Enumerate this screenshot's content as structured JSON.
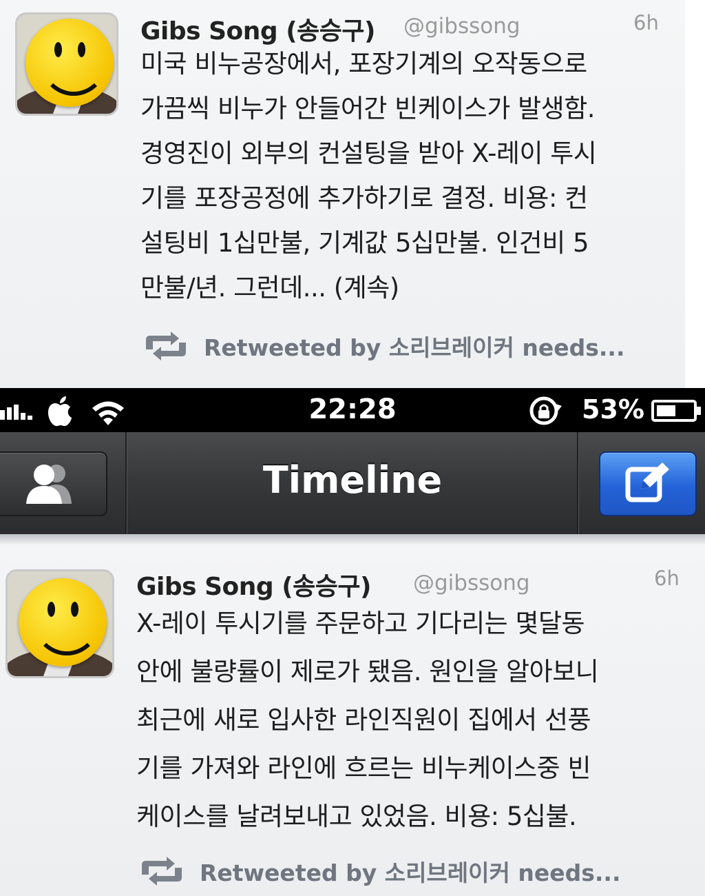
{
  "tweets": [
    {
      "name": "Gibs Song (송승구)",
      "handle": "@gibssong",
      "time": "6h",
      "lines": [
        "미국 비누공장에서, 포장기계의 오작동으로",
        "가끔씩 비누가 안들어간 빈케이스가 발생함.",
        "경영진이 외부의 컨설팅을 받아 X-레이 투시",
        "기를 포장공정에 추가하기로 결정. 비용: 컨",
        "설팅비 1십만불, 기계값 5십만불. 인건비 5",
        "만불/년. 그런데... (계속)"
      ],
      "retweet": "Retweeted by 소리브레이커 needs...",
      "avatar_icon": "smiley-avatar-icon"
    },
    {
      "name": "Gibs Song (송승구)",
      "handle": "@gibssong",
      "time": "6h",
      "lines": [
        "X-레이 투시기를 주문하고 기다리는 몇달동",
        "안에 불량률이 제로가 됐음. 원인을 알아보니",
        "최근에 새로 입사한 라인직원이 집에서 선풍",
        "기를 가져와 라인에 흐르는 비누케이스중 빈",
        "케이스를 날려보내고 있었음.  비용: 5십불."
      ],
      "retweet": "Retweeted by 소리브레이커 needs...",
      "avatar_icon": "smiley-avatar-icon"
    }
  ],
  "status_bar": {
    "time": "22:28",
    "battery_percent": "53%",
    "icons": [
      "signal-bars-icon",
      "apple-logo-icon",
      "wifi-icon",
      "rotation-lock-icon",
      "battery-icon"
    ]
  },
  "nav_bar": {
    "title": "Timeline",
    "left_button_icon": "people-icon",
    "right_button_icon": "compose-icon"
  },
  "colors": {
    "compose_button": "#2462d8",
    "nav_bar": "#38393b",
    "retweet_text": "#6f7680",
    "secondary_text": "#9a9a9a"
  }
}
